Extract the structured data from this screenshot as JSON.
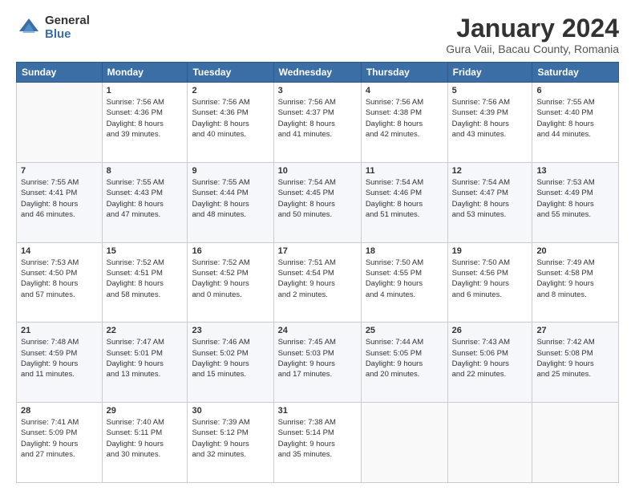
{
  "logo": {
    "general": "General",
    "blue": "Blue"
  },
  "title": "January 2024",
  "subtitle": "Gura Vaii, Bacau County, Romania",
  "headers": [
    "Sunday",
    "Monday",
    "Tuesday",
    "Wednesday",
    "Thursday",
    "Friday",
    "Saturday"
  ],
  "weeks": [
    [
      {
        "day": "",
        "content": ""
      },
      {
        "day": "1",
        "content": "Sunrise: 7:56 AM\nSunset: 4:36 PM\nDaylight: 8 hours\nand 39 minutes."
      },
      {
        "day": "2",
        "content": "Sunrise: 7:56 AM\nSunset: 4:36 PM\nDaylight: 8 hours\nand 40 minutes."
      },
      {
        "day": "3",
        "content": "Sunrise: 7:56 AM\nSunset: 4:37 PM\nDaylight: 8 hours\nand 41 minutes."
      },
      {
        "day": "4",
        "content": "Sunrise: 7:56 AM\nSunset: 4:38 PM\nDaylight: 8 hours\nand 42 minutes."
      },
      {
        "day": "5",
        "content": "Sunrise: 7:56 AM\nSunset: 4:39 PM\nDaylight: 8 hours\nand 43 minutes."
      },
      {
        "day": "6",
        "content": "Sunrise: 7:55 AM\nSunset: 4:40 PM\nDaylight: 8 hours\nand 44 minutes."
      }
    ],
    [
      {
        "day": "7",
        "content": "Sunrise: 7:55 AM\nSunset: 4:41 PM\nDaylight: 8 hours\nand 46 minutes."
      },
      {
        "day": "8",
        "content": "Sunrise: 7:55 AM\nSunset: 4:43 PM\nDaylight: 8 hours\nand 47 minutes."
      },
      {
        "day": "9",
        "content": "Sunrise: 7:55 AM\nSunset: 4:44 PM\nDaylight: 8 hours\nand 48 minutes."
      },
      {
        "day": "10",
        "content": "Sunrise: 7:54 AM\nSunset: 4:45 PM\nDaylight: 8 hours\nand 50 minutes."
      },
      {
        "day": "11",
        "content": "Sunrise: 7:54 AM\nSunset: 4:46 PM\nDaylight: 8 hours\nand 51 minutes."
      },
      {
        "day": "12",
        "content": "Sunrise: 7:54 AM\nSunset: 4:47 PM\nDaylight: 8 hours\nand 53 minutes."
      },
      {
        "day": "13",
        "content": "Sunrise: 7:53 AM\nSunset: 4:49 PM\nDaylight: 8 hours\nand 55 minutes."
      }
    ],
    [
      {
        "day": "14",
        "content": "Sunrise: 7:53 AM\nSunset: 4:50 PM\nDaylight: 8 hours\nand 57 minutes."
      },
      {
        "day": "15",
        "content": "Sunrise: 7:52 AM\nSunset: 4:51 PM\nDaylight: 8 hours\nand 58 minutes."
      },
      {
        "day": "16",
        "content": "Sunrise: 7:52 AM\nSunset: 4:52 PM\nDaylight: 9 hours\nand 0 minutes."
      },
      {
        "day": "17",
        "content": "Sunrise: 7:51 AM\nSunset: 4:54 PM\nDaylight: 9 hours\nand 2 minutes."
      },
      {
        "day": "18",
        "content": "Sunrise: 7:50 AM\nSunset: 4:55 PM\nDaylight: 9 hours\nand 4 minutes."
      },
      {
        "day": "19",
        "content": "Sunrise: 7:50 AM\nSunset: 4:56 PM\nDaylight: 9 hours\nand 6 minutes."
      },
      {
        "day": "20",
        "content": "Sunrise: 7:49 AM\nSunset: 4:58 PM\nDaylight: 9 hours\nand 8 minutes."
      }
    ],
    [
      {
        "day": "21",
        "content": "Sunrise: 7:48 AM\nSunset: 4:59 PM\nDaylight: 9 hours\nand 11 minutes."
      },
      {
        "day": "22",
        "content": "Sunrise: 7:47 AM\nSunset: 5:01 PM\nDaylight: 9 hours\nand 13 minutes."
      },
      {
        "day": "23",
        "content": "Sunrise: 7:46 AM\nSunset: 5:02 PM\nDaylight: 9 hours\nand 15 minutes."
      },
      {
        "day": "24",
        "content": "Sunrise: 7:45 AM\nSunset: 5:03 PM\nDaylight: 9 hours\nand 17 minutes."
      },
      {
        "day": "25",
        "content": "Sunrise: 7:44 AM\nSunset: 5:05 PM\nDaylight: 9 hours\nand 20 minutes."
      },
      {
        "day": "26",
        "content": "Sunrise: 7:43 AM\nSunset: 5:06 PM\nDaylight: 9 hours\nand 22 minutes."
      },
      {
        "day": "27",
        "content": "Sunrise: 7:42 AM\nSunset: 5:08 PM\nDaylight: 9 hours\nand 25 minutes."
      }
    ],
    [
      {
        "day": "28",
        "content": "Sunrise: 7:41 AM\nSunset: 5:09 PM\nDaylight: 9 hours\nand 27 minutes."
      },
      {
        "day": "29",
        "content": "Sunrise: 7:40 AM\nSunset: 5:11 PM\nDaylight: 9 hours\nand 30 minutes."
      },
      {
        "day": "30",
        "content": "Sunrise: 7:39 AM\nSunset: 5:12 PM\nDaylight: 9 hours\nand 32 minutes."
      },
      {
        "day": "31",
        "content": "Sunrise: 7:38 AM\nSunset: 5:14 PM\nDaylight: 9 hours\nand 35 minutes."
      },
      {
        "day": "",
        "content": ""
      },
      {
        "day": "",
        "content": ""
      },
      {
        "day": "",
        "content": ""
      }
    ]
  ]
}
